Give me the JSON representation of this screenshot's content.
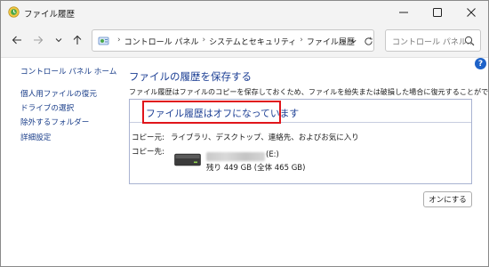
{
  "window": {
    "title": "ファイル履歴"
  },
  "addressbar": {
    "crumbs": [
      "コントロール パネル",
      "システムとセキュリティ",
      "ファイル履歴"
    ]
  },
  "search": {
    "placeholder": "コントロール パネル..."
  },
  "sidebar": {
    "home": "コントロール パネル ホーム",
    "items": [
      {
        "label": "個人用ファイルの復元"
      },
      {
        "label": "ドライブの選択"
      },
      {
        "label": "除外するフォルダー"
      },
      {
        "label": "詳細設定"
      }
    ]
  },
  "main": {
    "title": "ファイルの履歴を保存する",
    "description": "ファイル履歴はファイルのコピーを保存しておくため、ファイルを紛失または破損した場合に復元することができます。",
    "status": "ファイル履歴はオフになっています",
    "copy_from_label": "コピー元:",
    "copy_from_value": "ライブラリ、デスクトップ、連絡先、およびお気に入り",
    "copy_to_label": "コピー先:",
    "drive_letter": "(E:)",
    "drive_space": "残り 449 GB (全体 465 GB)",
    "turn_on_button": "オンにする"
  },
  "colors": {
    "link": "#1a3e8a",
    "heading": "#1c3f94",
    "highlight": "#e0151b",
    "help": "#1d62c8"
  }
}
